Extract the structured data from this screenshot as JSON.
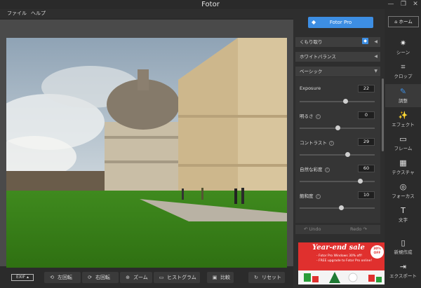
{
  "window": {
    "title": "Fotor",
    "controls": [
      "—",
      "❐",
      "✕"
    ]
  },
  "menu": {
    "items": [
      "ファイル",
      "ヘルプ"
    ]
  },
  "bottombar": {
    "exif_label": "EXIF",
    "buttons": [
      {
        "icon": "rotate-left-icon",
        "glyph": "⟲",
        "label": "左回転"
      },
      {
        "icon": "rotate-right-icon",
        "glyph": "⟳",
        "label": "右回転"
      },
      {
        "icon": "zoom-icon",
        "glyph": "⊕",
        "label": "ズーム"
      },
      {
        "icon": "histogram-icon",
        "glyph": "▭",
        "label": "ヒストグラム"
      },
      {
        "icon": "compare-icon",
        "glyph": "▣",
        "label": "比較"
      },
      {
        "icon": "reset-icon",
        "glyph": "↻",
        "label": "リセット"
      }
    ]
  },
  "panel": {
    "pro_button": "Fotor Pro",
    "sections": {
      "cloudy": "くもり取り",
      "white_balance": "ホワイトバランス",
      "basic": "ベーシック"
    },
    "sliders": [
      {
        "label": "Exposure",
        "value": "22",
        "level": 0.61
      },
      {
        "label": "明るさ",
        "value": "0",
        "level": 0.5
      },
      {
        "label": "コントラスト",
        "value": "29",
        "level": 0.64
      },
      {
        "label": "自然な彩度",
        "value": "60",
        "level": 0.8
      },
      {
        "label": "飽和度",
        "value": "10",
        "level": 0.55
      }
    ],
    "undo": "Undo",
    "redo": "Redo"
  },
  "sidebar": {
    "home": "ホーム",
    "items": [
      {
        "icon": "scene-icon",
        "glyph": "✷",
        "label": "シーン"
      },
      {
        "icon": "crop-icon",
        "glyph": "⌗",
        "label": "クロップ"
      },
      {
        "icon": "adjust-icon",
        "glyph": "✎",
        "label": "調整"
      },
      {
        "icon": "effect-icon",
        "glyph": "✨",
        "label": "エフェクト"
      },
      {
        "icon": "frame-icon",
        "glyph": "▭",
        "label": "フレーム"
      },
      {
        "icon": "texture-icon",
        "glyph": "▦",
        "label": "テクスチャ"
      },
      {
        "icon": "focus-icon",
        "glyph": "◎",
        "label": "フォーカス"
      },
      {
        "icon": "text-icon",
        "glyph": "T",
        "label": "文字"
      },
      {
        "icon": "new-icon",
        "glyph": "▯",
        "label": "新規作成"
      },
      {
        "icon": "export-icon",
        "glyph": "⇥",
        "label": "エクスポート"
      }
    ]
  },
  "ad": {
    "title": "Year-end sale",
    "line1": "- Fotor Pro Windows 30% off!",
    "line2": "- FREE upgrade to Fotor Pro online!",
    "badge": "30% OFF"
  },
  "colors": {
    "accent": "#3d8ee3",
    "ad_red": "#e0302e"
  }
}
